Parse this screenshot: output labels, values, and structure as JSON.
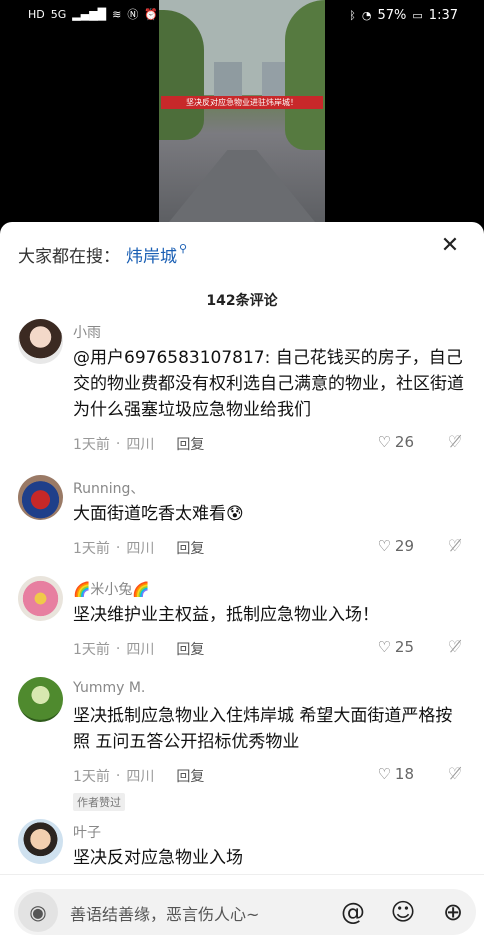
{
  "status": {
    "left_icons": [
      "HD",
      "5G",
      "signal-bars",
      "wifi",
      "nfc",
      "alarm-off",
      "vibrate-off"
    ],
    "battery": "57%",
    "time": "1:37"
  },
  "video": {
    "banner_text": "坚决反对应急物业进驻炜岸城！"
  },
  "search_hint": {
    "label": "大家都在搜：",
    "keyword": "炜岸城"
  },
  "comments_count": "142条评论",
  "comments": [
    {
      "name": "小雨",
      "text": "@用户6976583107817: 自己花钱买的房子，自己交的物业费都没有权利选自己满意的物业，社区街道为什么强塞垃圾应急物业给我们",
      "time": "1天前",
      "location": "四川",
      "reply": "回复",
      "likes": "26"
    },
    {
      "name": "Running、",
      "text": "大面街道吃香太难看😰",
      "time": "1天前",
      "location": "四川",
      "reply": "回复",
      "likes": "29"
    },
    {
      "name": "🌈米小兔🌈",
      "text": "坚决维护业主权益，抵制应急物业入场！",
      "time": "1天前",
      "location": "四川",
      "reply": "回复",
      "likes": "25"
    },
    {
      "name": "Yummy M.",
      "text": "坚决抵制应急物业入住炜岸城  希望大面街道严格按照 五问五答公开招标优秀物业",
      "time": "1天前",
      "location": "四川",
      "reply": "回复",
      "likes": "18",
      "badge": "作者赞过"
    },
    {
      "name": "叶子",
      "text": "坚决反对应急物业入场"
    }
  ],
  "input": {
    "placeholder": "善语结善缘，恶言伤人心~"
  }
}
